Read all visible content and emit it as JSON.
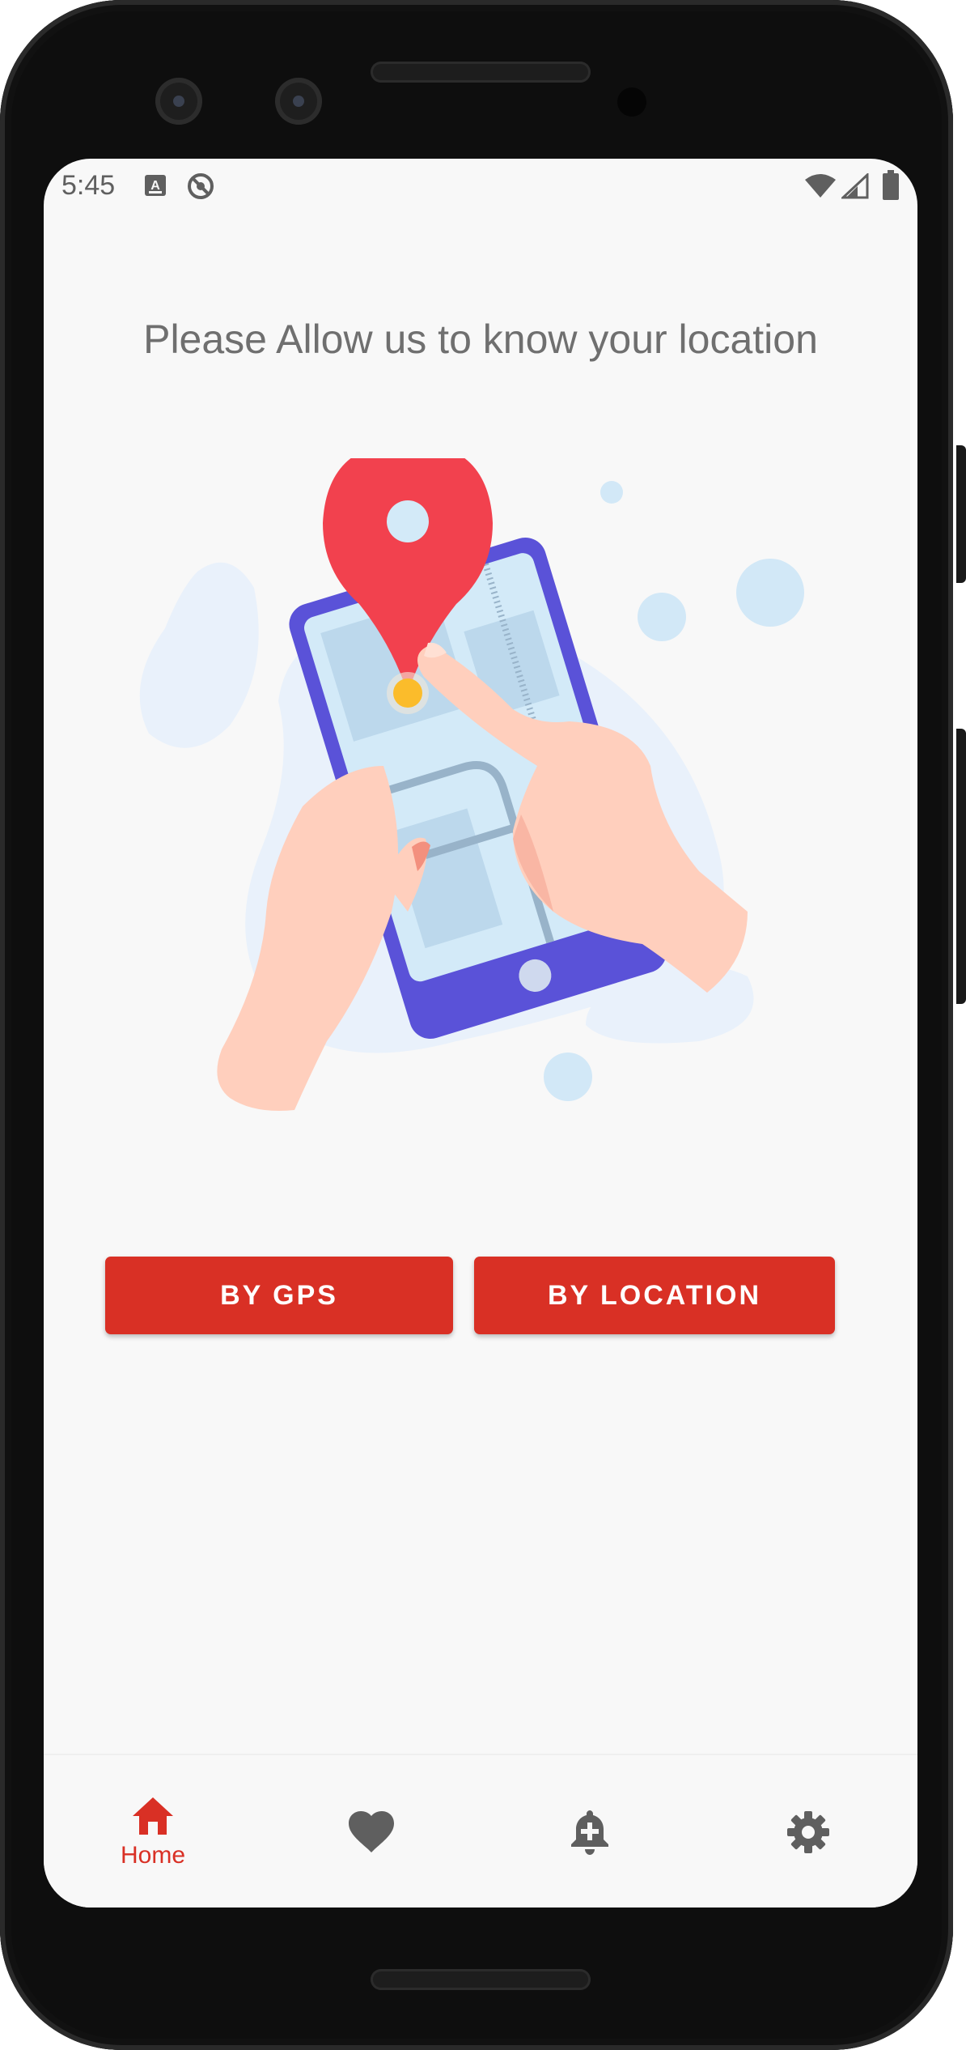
{
  "status_bar": {
    "time": "5:45",
    "left_icons": [
      "keyboard-a-icon",
      "sync-blocked-icon"
    ],
    "right_icons": [
      "wifi-icon",
      "cell-signal-icon",
      "battery-icon"
    ]
  },
  "main": {
    "headline": "Please Allow us to know your location",
    "illustration": "hand-holding-phone-map-location-pin",
    "buttons": {
      "gps_label": "BY GPS",
      "location_label": "BY LOCATION"
    }
  },
  "bottom_nav": {
    "items": [
      {
        "icon": "home-icon",
        "label": "Home",
        "active": true
      },
      {
        "icon": "heart-icon",
        "label": "",
        "active": false
      },
      {
        "icon": "add-alert-icon",
        "label": "",
        "active": false
      },
      {
        "icon": "gear-icon",
        "label": "",
        "active": false
      }
    ]
  },
  "colors": {
    "accent": "#d93025",
    "inactive_icon": "#5f5f5f",
    "background": "#f8f8f8",
    "headline_text": "#6f6f6f",
    "pin": "#f2414e",
    "phone_frame": "#5a52d8"
  }
}
